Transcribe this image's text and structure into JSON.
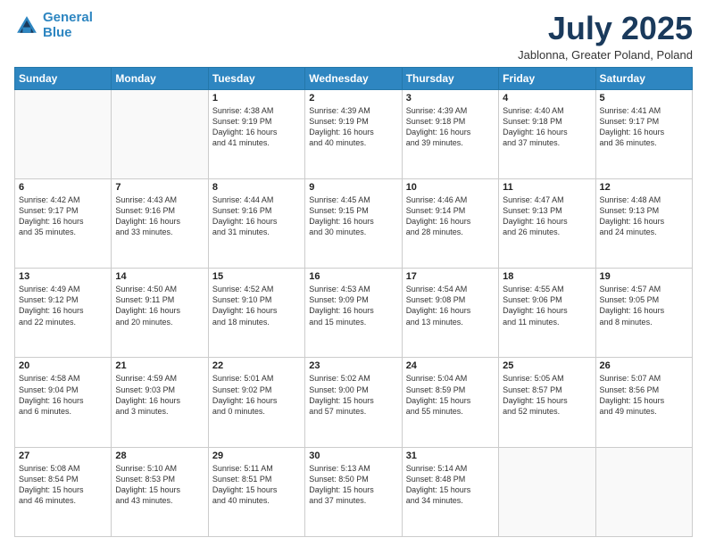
{
  "logo": {
    "line1": "General",
    "line2": "Blue"
  },
  "title": "July 2025",
  "subtitle": "Jablonna, Greater Poland, Poland",
  "header_days": [
    "Sunday",
    "Monday",
    "Tuesday",
    "Wednesday",
    "Thursday",
    "Friday",
    "Saturday"
  ],
  "weeks": [
    [
      {
        "day": "",
        "info": ""
      },
      {
        "day": "",
        "info": ""
      },
      {
        "day": "1",
        "info": "Sunrise: 4:38 AM\nSunset: 9:19 PM\nDaylight: 16 hours\nand 41 minutes."
      },
      {
        "day": "2",
        "info": "Sunrise: 4:39 AM\nSunset: 9:19 PM\nDaylight: 16 hours\nand 40 minutes."
      },
      {
        "day": "3",
        "info": "Sunrise: 4:39 AM\nSunset: 9:18 PM\nDaylight: 16 hours\nand 39 minutes."
      },
      {
        "day": "4",
        "info": "Sunrise: 4:40 AM\nSunset: 9:18 PM\nDaylight: 16 hours\nand 37 minutes."
      },
      {
        "day": "5",
        "info": "Sunrise: 4:41 AM\nSunset: 9:17 PM\nDaylight: 16 hours\nand 36 minutes."
      }
    ],
    [
      {
        "day": "6",
        "info": "Sunrise: 4:42 AM\nSunset: 9:17 PM\nDaylight: 16 hours\nand 35 minutes."
      },
      {
        "day": "7",
        "info": "Sunrise: 4:43 AM\nSunset: 9:16 PM\nDaylight: 16 hours\nand 33 minutes."
      },
      {
        "day": "8",
        "info": "Sunrise: 4:44 AM\nSunset: 9:16 PM\nDaylight: 16 hours\nand 31 minutes."
      },
      {
        "day": "9",
        "info": "Sunrise: 4:45 AM\nSunset: 9:15 PM\nDaylight: 16 hours\nand 30 minutes."
      },
      {
        "day": "10",
        "info": "Sunrise: 4:46 AM\nSunset: 9:14 PM\nDaylight: 16 hours\nand 28 minutes."
      },
      {
        "day": "11",
        "info": "Sunrise: 4:47 AM\nSunset: 9:13 PM\nDaylight: 16 hours\nand 26 minutes."
      },
      {
        "day": "12",
        "info": "Sunrise: 4:48 AM\nSunset: 9:13 PM\nDaylight: 16 hours\nand 24 minutes."
      }
    ],
    [
      {
        "day": "13",
        "info": "Sunrise: 4:49 AM\nSunset: 9:12 PM\nDaylight: 16 hours\nand 22 minutes."
      },
      {
        "day": "14",
        "info": "Sunrise: 4:50 AM\nSunset: 9:11 PM\nDaylight: 16 hours\nand 20 minutes."
      },
      {
        "day": "15",
        "info": "Sunrise: 4:52 AM\nSunset: 9:10 PM\nDaylight: 16 hours\nand 18 minutes."
      },
      {
        "day": "16",
        "info": "Sunrise: 4:53 AM\nSunset: 9:09 PM\nDaylight: 16 hours\nand 15 minutes."
      },
      {
        "day": "17",
        "info": "Sunrise: 4:54 AM\nSunset: 9:08 PM\nDaylight: 16 hours\nand 13 minutes."
      },
      {
        "day": "18",
        "info": "Sunrise: 4:55 AM\nSunset: 9:06 PM\nDaylight: 16 hours\nand 11 minutes."
      },
      {
        "day": "19",
        "info": "Sunrise: 4:57 AM\nSunset: 9:05 PM\nDaylight: 16 hours\nand 8 minutes."
      }
    ],
    [
      {
        "day": "20",
        "info": "Sunrise: 4:58 AM\nSunset: 9:04 PM\nDaylight: 16 hours\nand 6 minutes."
      },
      {
        "day": "21",
        "info": "Sunrise: 4:59 AM\nSunset: 9:03 PM\nDaylight: 16 hours\nand 3 minutes."
      },
      {
        "day": "22",
        "info": "Sunrise: 5:01 AM\nSunset: 9:02 PM\nDaylight: 16 hours\nand 0 minutes."
      },
      {
        "day": "23",
        "info": "Sunrise: 5:02 AM\nSunset: 9:00 PM\nDaylight: 15 hours\nand 57 minutes."
      },
      {
        "day": "24",
        "info": "Sunrise: 5:04 AM\nSunset: 8:59 PM\nDaylight: 15 hours\nand 55 minutes."
      },
      {
        "day": "25",
        "info": "Sunrise: 5:05 AM\nSunset: 8:57 PM\nDaylight: 15 hours\nand 52 minutes."
      },
      {
        "day": "26",
        "info": "Sunrise: 5:07 AM\nSunset: 8:56 PM\nDaylight: 15 hours\nand 49 minutes."
      }
    ],
    [
      {
        "day": "27",
        "info": "Sunrise: 5:08 AM\nSunset: 8:54 PM\nDaylight: 15 hours\nand 46 minutes."
      },
      {
        "day": "28",
        "info": "Sunrise: 5:10 AM\nSunset: 8:53 PM\nDaylight: 15 hours\nand 43 minutes."
      },
      {
        "day": "29",
        "info": "Sunrise: 5:11 AM\nSunset: 8:51 PM\nDaylight: 15 hours\nand 40 minutes."
      },
      {
        "day": "30",
        "info": "Sunrise: 5:13 AM\nSunset: 8:50 PM\nDaylight: 15 hours\nand 37 minutes."
      },
      {
        "day": "31",
        "info": "Sunrise: 5:14 AM\nSunset: 8:48 PM\nDaylight: 15 hours\nand 34 minutes."
      },
      {
        "day": "",
        "info": ""
      },
      {
        "day": "",
        "info": ""
      }
    ]
  ]
}
